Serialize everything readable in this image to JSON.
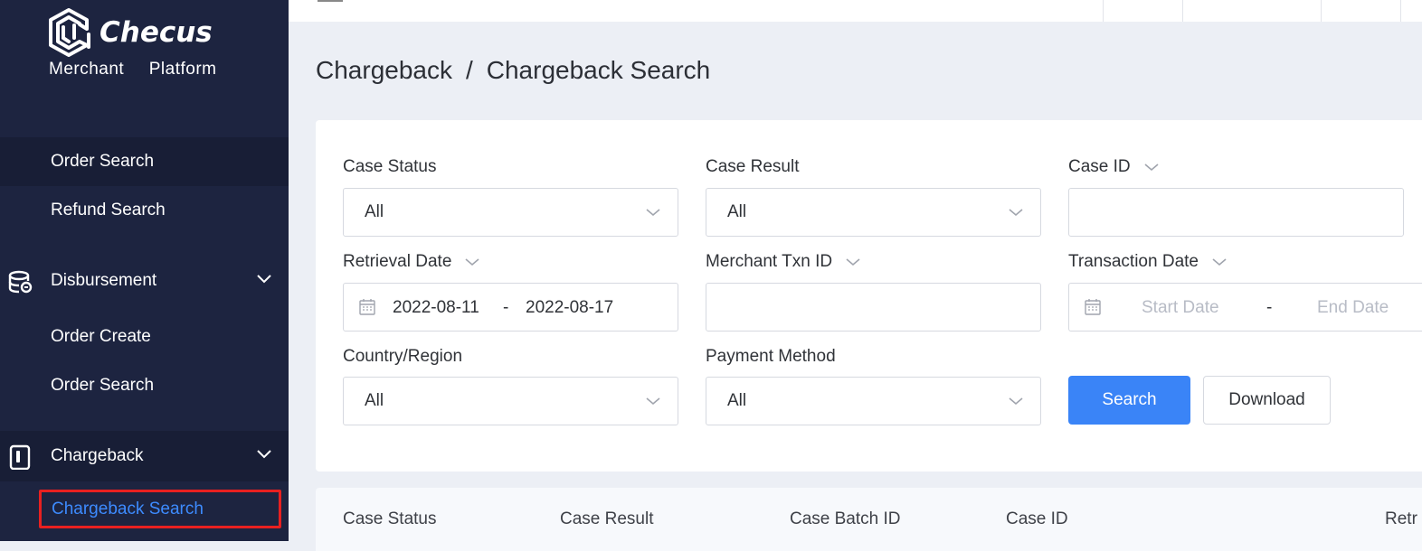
{
  "brand": {
    "name": "Checus",
    "subtitle": "Merchant  Platform"
  },
  "sidebar": {
    "items": [
      {
        "label": "Order Search",
        "type": "sub"
      },
      {
        "label": "Refund Search",
        "type": "sub"
      },
      {
        "label": "Disbursement",
        "type": "group",
        "icon": "database-icon"
      },
      {
        "label": "Order Create",
        "type": "sub"
      },
      {
        "label": "Order Search",
        "type": "sub"
      },
      {
        "label": "Chargeback",
        "type": "group",
        "icon": "mobile-icon"
      },
      {
        "label": "Chargeback Search",
        "type": "sub",
        "selected": true
      }
    ]
  },
  "breadcrumb": {
    "parent": "Chargeback",
    "separator": "/",
    "current": "Chargeback Search"
  },
  "filters": {
    "case_status": {
      "label": "Case Status",
      "value": "All"
    },
    "case_result": {
      "label": "Case Result",
      "value": "All"
    },
    "case_id": {
      "label": "Case ID",
      "value": ""
    },
    "retrieval_date": {
      "label": "Retrieval Date",
      "start": "2022-08-11",
      "separator": "-",
      "end": "2022-08-17"
    },
    "merchant_txn_id": {
      "label": "Merchant Txn ID",
      "value": ""
    },
    "transaction_date": {
      "label": "Transaction Date",
      "start_placeholder": "Start Date",
      "separator": "-",
      "end_placeholder": "End Date"
    },
    "country_region": {
      "label": "Country/Region",
      "value": "All"
    },
    "payment_method": {
      "label": "Payment Method",
      "value": "All"
    }
  },
  "buttons": {
    "search": "Search",
    "download": "Download"
  },
  "table": {
    "columns": [
      "Case Status",
      "Case Result",
      "Case Batch ID",
      "Case ID",
      "Retr"
    ]
  },
  "colors": {
    "sidebar_bg": "#1d2440",
    "accent": "#3a84f7",
    "selected_text": "#3d8bff",
    "highlight_border": "#e82020"
  }
}
